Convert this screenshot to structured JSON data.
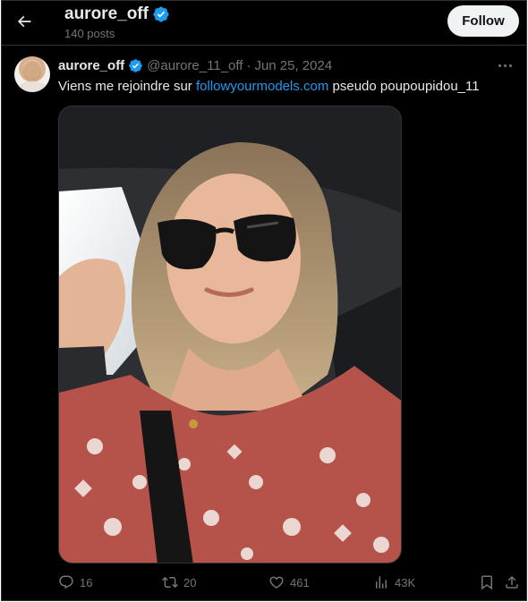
{
  "header": {
    "back_icon": "arrow-left-icon",
    "name": "aurore_off",
    "posts": "140 posts",
    "follow_label": "Follow"
  },
  "tweet": {
    "name": "aurore_off",
    "handle": "@aurore_11_off",
    "separator": "·",
    "date": "Jun 25, 2024",
    "text_before": "Viens me rejoindre sur ",
    "link_text": "followyourmodels.com",
    "text_after": " pseudo poupoupidou_11"
  },
  "actions": {
    "replies": "16",
    "reposts": "20",
    "likes": "461",
    "views": "43K"
  },
  "colors": {
    "background": "#000000",
    "text": "#e7e9ea",
    "muted": "#71767b",
    "link": "#1d9bf0",
    "verified": "#1d9bf0",
    "follow_bg": "#eff3f4"
  },
  "icons": [
    "arrow-left-icon",
    "verified-badge-icon",
    "more-icon",
    "reply-icon",
    "repost-icon",
    "like-icon",
    "views-icon",
    "bookmark-icon",
    "share-icon"
  ]
}
